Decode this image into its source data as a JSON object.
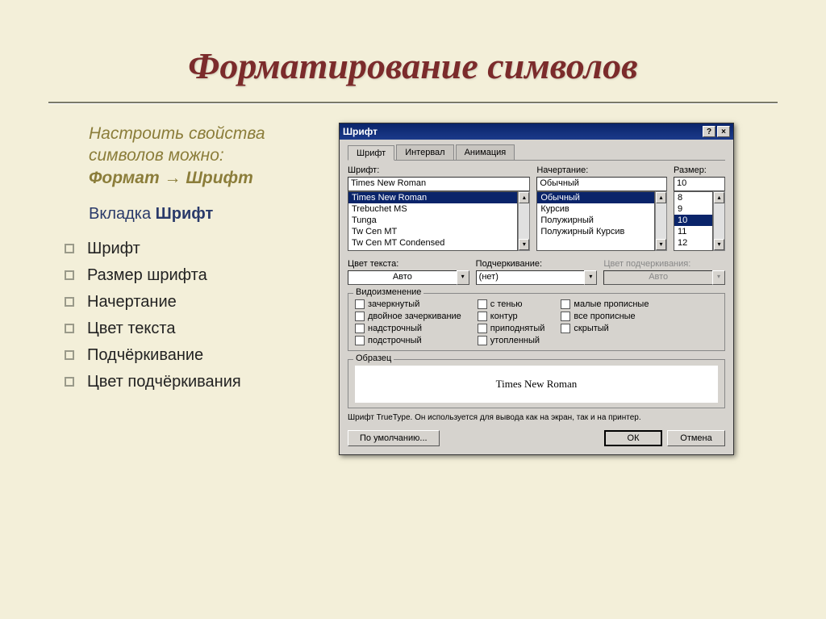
{
  "slide": {
    "title": "Форматирование символов",
    "intro_line1": "Настроить свойства символов можно:",
    "intro_path": "Формат → Шрифт",
    "tab_prefix": "Вкладка ",
    "tab_bold": "Шрифт",
    "bullets": [
      "Шрифт",
      "Размер шрифта",
      "Начертание",
      "Цвет текста",
      "Подчёркивание",
      "Цвет подчёркивания"
    ]
  },
  "dialog": {
    "title": "Шрифт",
    "help_btn": "?",
    "close_btn": "×",
    "tabs": [
      "Шрифт",
      "Интервал",
      "Анимация"
    ],
    "font": {
      "label": "Шрифт:",
      "value": "Times New Roman",
      "options": [
        "Times New Roman",
        "Trebuchet MS",
        "Tunga",
        "Tw Cen MT",
        "Tw Cen MT Condensed"
      ]
    },
    "style": {
      "label": "Начертание:",
      "value": "Обычный",
      "options": [
        "Обычный",
        "Курсив",
        "Полужирный",
        "Полужирный Курсив"
      ]
    },
    "size": {
      "label": "Размер:",
      "value": "10",
      "options": [
        "8",
        "9",
        "10",
        "11",
        "12"
      ]
    },
    "text_color": {
      "label": "Цвет текста:",
      "value": "Авто"
    },
    "underline": {
      "label": "Подчеркивание:",
      "value": "(нет)"
    },
    "underline_color": {
      "label": "Цвет подчеркивания:",
      "value": "Авто"
    },
    "effects_title": "Видоизменение",
    "effects_col1": [
      "зачеркнутый",
      "двойное зачеркивание",
      "надстрочный",
      "подстрочный"
    ],
    "effects_col2": [
      "с тенью",
      "контур",
      "приподнятый",
      "утопленный"
    ],
    "effects_col3": [
      "малые прописные",
      "все прописные",
      "скрытый"
    ],
    "sample_title": "Образец",
    "sample_text": "Times New Roman",
    "hint": "Шрифт TrueType. Он используется для вывода как на экран, так и на принтер.",
    "buttons": {
      "default": "По умолчанию...",
      "ok": "ОК",
      "cancel": "Отмена"
    }
  }
}
